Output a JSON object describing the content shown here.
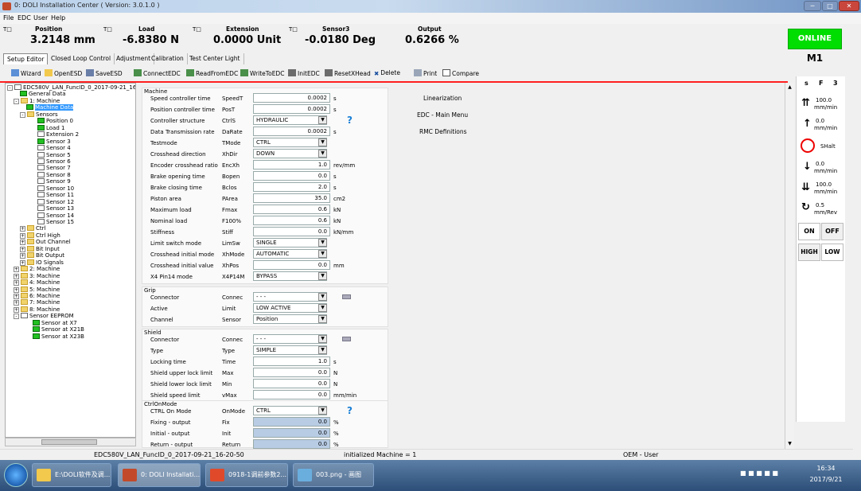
{
  "window": {
    "title": "0: DOLI Installation Center ( Version: 3.0.1.0 )"
  },
  "menu": [
    "File",
    "EDC",
    "User",
    "Help"
  ],
  "readouts": [
    {
      "t": "T",
      "name": "Position",
      "value": "3.2148 mm"
    },
    {
      "t": "T",
      "name": "Load",
      "value": "-6.8380 N"
    },
    {
      "t": "T",
      "name": "Extension",
      "value": "0.0000 Unit"
    },
    {
      "t": "T",
      "name": "Sensor3",
      "value": "-0.0180 Deg"
    },
    {
      "name": "Output",
      "value": "0.6266 %"
    }
  ],
  "online": "ONLINE",
  "machine_id": "M1",
  "tabs": [
    "Setup Editor",
    "Closed Loop Control",
    "Adjustment",
    "Calibration",
    "Test Center Light"
  ],
  "toolbar": [
    "Wizard",
    "OpenESD",
    "SaveESD",
    "ConnectEDC",
    "ReadFromEDC",
    "WriteToEDC",
    "InitEDC",
    "ResetXHead",
    "Delete",
    "Print",
    "Compare"
  ],
  "tree": {
    "root": "EDC580V_LAN_FuncID_0_2017-09-21_16",
    "general": "General Data",
    "machine1": "1: Machine",
    "machine_data": "Machine Data",
    "sensors": "Sensors",
    "sensor_items": [
      "Position 0",
      "Load 1",
      "Extension 2",
      "Sensor 3",
      "Sensor 4",
      "Sensor 5",
      "Sensor 6",
      "Sensor 7",
      "Sensor 8",
      "Sensor 9",
      "Sensor 10",
      "Sensor 11",
      "Sensor 12",
      "Sensor 13",
      "Sensor 14",
      "Sensor 15"
    ],
    "groups": [
      "Ctrl",
      "Ctrl High",
      "Out Channel",
      "Bit Input",
      "Bit Output",
      "IO Signals"
    ],
    "machines": [
      "2: Machine",
      "3: Machine",
      "4: Machine",
      "5: Machine",
      "6: Machine",
      "7: Machine",
      "8: Machine"
    ],
    "eeprom": "Sensor EEPROM",
    "eeprom_items": [
      "Sensor at X7",
      "Sensor at X21B",
      "Sensor at X23B"
    ]
  },
  "form": {
    "machine_title": "Machine",
    "machine_rows": [
      {
        "label": "Speed controller time",
        "abbr": "SpeedT",
        "value": "0.0002",
        "unit": "s"
      },
      {
        "label": "Position controller time",
        "abbr": "PosT",
        "value": "0.0002",
        "unit": "s"
      },
      {
        "label": "Controller structure",
        "abbr": "CtrlS",
        "select": "HYDRAULIC",
        "help": "?"
      },
      {
        "label": "Data Transmission rate",
        "abbr": "DaRate",
        "value": "0.0002",
        "unit": "s"
      },
      {
        "label": "Testmode",
        "abbr": "TMode",
        "select": "CTRL"
      },
      {
        "label": "Crosshead direction",
        "abbr": "XhDir",
        "select": "DOWN"
      },
      {
        "label": "Encoder crosshead ratio",
        "abbr": "EncXh",
        "value": "1.0",
        "unit": "rev/mm"
      },
      {
        "label": "Brake opening time",
        "abbr": "Bopen",
        "value": "0.0",
        "unit": "s"
      },
      {
        "label": "Brake closing time",
        "abbr": "Bclos",
        "value": "2.0",
        "unit": "s"
      },
      {
        "label": "Piston area",
        "abbr": "PArea",
        "value": "35.0",
        "unit": "cm2"
      },
      {
        "label": "Maximum load",
        "abbr": "Fmax",
        "value": "0.6",
        "unit": "kN"
      },
      {
        "label": "Nominal load",
        "abbr": "F100%",
        "value": "0.6",
        "unit": "kN"
      },
      {
        "label": "Stiffness",
        "abbr": "Stiff",
        "value": "0.0",
        "unit": "kN/mm"
      },
      {
        "label": "Limit switch mode",
        "abbr": "LimSw",
        "select": "SINGLE"
      },
      {
        "label": "Crosshead initial mode",
        "abbr": "XhMode",
        "select": "AUTOMATIC"
      },
      {
        "label": "Crosshead initial value",
        "abbr": "XhPos",
        "value": "0.0",
        "unit": "mm"
      },
      {
        "label": "X4 Pin14 mode",
        "abbr": "X4P14M",
        "select": "BYPASS"
      }
    ],
    "grip_title": "Grip",
    "grip_rows": [
      {
        "label": "Connector",
        "abbr": "Connec",
        "select": "- - -",
        "conn": true
      },
      {
        "label": "Active",
        "abbr": "Limit",
        "select": "LOW ACTIVE"
      },
      {
        "label": "Channel",
        "abbr": "Sensor",
        "select": "Position"
      }
    ],
    "shield_title": "Shield",
    "shield_rows": [
      {
        "label": "Connector",
        "abbr": "Connec",
        "select": "- - -",
        "conn": true
      },
      {
        "label": "Type",
        "abbr": "Type",
        "select": "SIMPLE"
      },
      {
        "label": "Locking time",
        "abbr": "Time",
        "value": "1.0",
        "unit": "s"
      },
      {
        "label": "Shield upper lock limit",
        "abbr": "Max",
        "value": "0.0",
        "unit": "N"
      },
      {
        "label": "Shield lower lock limit",
        "abbr": "Min",
        "value": "0.0",
        "unit": "N"
      },
      {
        "label": "Shield speed limit",
        "abbr": "vMax",
        "value": "0.0",
        "unit": "mm/min"
      }
    ],
    "ctrl_title": "CtrlOnMode",
    "ctrl_rows": [
      {
        "label": "CTRL On Mode",
        "abbr": "OnMode",
        "select": "CTRL",
        "help": "?"
      },
      {
        "label": "Fixing - output",
        "abbr": "Fix",
        "value": "0.0",
        "unit": "%",
        "blue": true
      },
      {
        "label": "Initial - output",
        "abbr": "Init",
        "value": "0.0",
        "unit": "%",
        "blue": true
      },
      {
        "label": "Return - output",
        "abbr": "Return",
        "value": "0.0",
        "unit": "%",
        "blue": true
      }
    ]
  },
  "side_links": [
    "Linearization",
    "EDC - Main Menu",
    "RMC Definitions"
  ],
  "right_panel": {
    "modes": [
      "s",
      "F",
      "3"
    ],
    "up_fast": "100.0",
    "up_slow": "0.0",
    "halt": "SHalt",
    "down_slow": "0.0",
    "down_fast": "100.0",
    "unit": "mm/min",
    "rev_value": "0.5",
    "rev_unit": "mm/Rev",
    "on": "ON",
    "off": "OFF",
    "high": "HIGH",
    "low": "LOW"
  },
  "status": {
    "file": "EDC580V_LAN_FuncID_0_2017-09-21_16-20-50",
    "init": "initialized Machine = 1",
    "user": "OEM - User"
  },
  "taskbar": {
    "items": [
      "E:\\DOLI软件及调...",
      "0: DOLI Installati...",
      "0918-1调前参数2...",
      "003.png - 画图"
    ],
    "time": "16:34",
    "date": "2017/9/21"
  }
}
